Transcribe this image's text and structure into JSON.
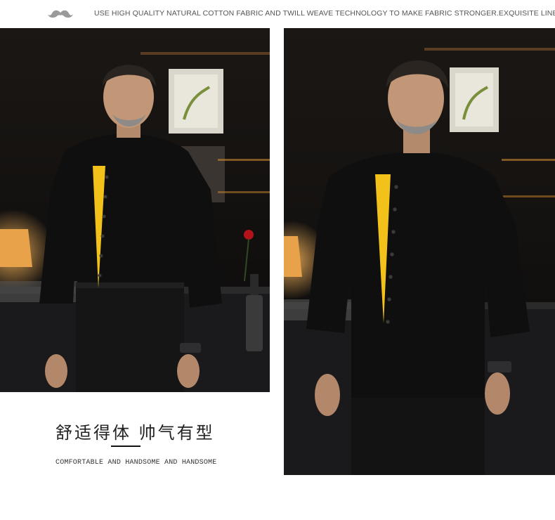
{
  "header": {
    "icon": "mustache-icon",
    "tagline": "USE HIGH QUALITY NATURAL COTTON FABRIC AND TWILL WEAVE TECHNOLOGY TO MAKE FABRIC STRONGER.EXQUISITE LINE."
  },
  "caption": {
    "title_cn": "舒适得体  帅气有型",
    "subtitle_en": "COMFORTABLE AND HANDSOME AND HANDSOME"
  },
  "colors": {
    "background": "#ffffff",
    "jacket": "#0e0e0e",
    "accent_stripe": "#f2c21b",
    "icon_gray": "#9a9a9a"
  }
}
